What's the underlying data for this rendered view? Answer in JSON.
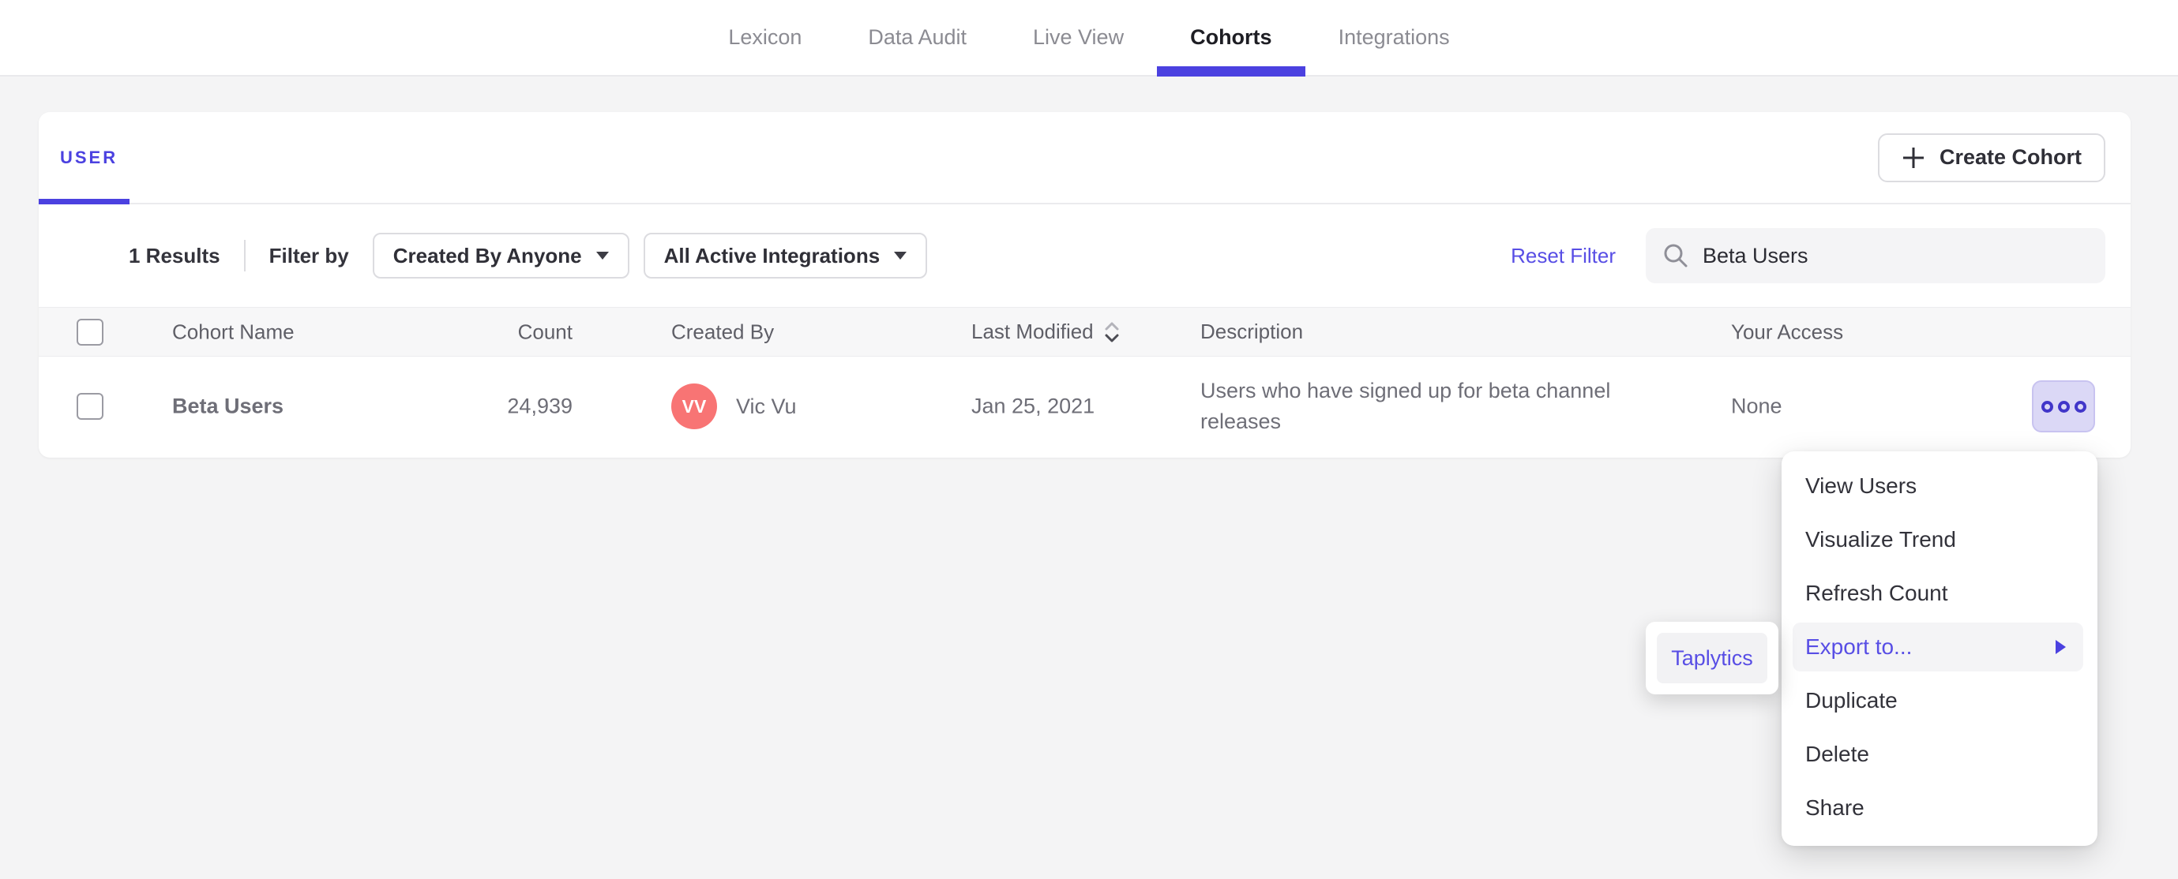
{
  "nav": {
    "tabs": [
      {
        "label": "Lexicon",
        "active": false
      },
      {
        "label": "Data Audit",
        "active": false
      },
      {
        "label": "Live View",
        "active": false
      },
      {
        "label": "Cohorts",
        "active": true
      },
      {
        "label": "Integrations",
        "active": false
      }
    ]
  },
  "panel": {
    "tab_label": "USER",
    "create_button": {
      "icon": "plus-icon",
      "label": "Create Cohort"
    },
    "filters": {
      "results_count": "1 Results",
      "filter_by_label": "Filter by",
      "created_by_dropdown": "Created By Anyone",
      "integrations_dropdown": "All Active Integrations",
      "reset_filter": "Reset Filter",
      "search": {
        "icon": "search-icon",
        "value": "Beta Users"
      }
    },
    "table": {
      "columns": [
        "Cohort Name",
        "Count",
        "Created By",
        "Last Modified",
        "Description",
        "Your Access"
      ],
      "rows": [
        {
          "name": "Beta Users",
          "count": "24,939",
          "created_by": {
            "initials": "VV",
            "name": "Vic Vu",
            "avatar_color": "#f87474"
          },
          "last_modified": "Jan 25, 2021",
          "description": "Users who have signed up for beta channel releases",
          "your_access": "None"
        }
      ]
    }
  },
  "context_menu": {
    "items": [
      "View Users",
      "Visualize Trend",
      "Refresh Count",
      "Export to...",
      "Duplicate",
      "Delete",
      "Share"
    ],
    "highlighted_item": "Export to...",
    "submenu": {
      "items": [
        "Taplytics"
      ]
    }
  },
  "colors": {
    "accent": "#4b41e0",
    "purple_link": "#584ee5",
    "avatar": "#f87474",
    "page_bg": "#f4f4f5",
    "table_header_bg": "#f7f7f8",
    "more_button_bg": "#dbd8f6"
  }
}
